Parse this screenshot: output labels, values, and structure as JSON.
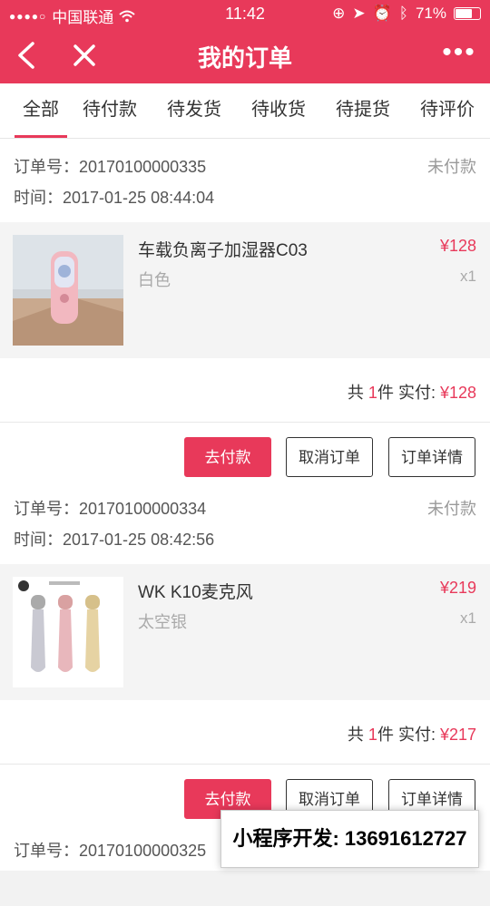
{
  "status_bar": {
    "carrier": "中国联通",
    "time": "11:42",
    "battery": "71%"
  },
  "navbar": {
    "title": "我的订单"
  },
  "tabs": [
    {
      "label": "全部"
    },
    {
      "label": "待付款"
    },
    {
      "label": "待发货"
    },
    {
      "label": "待收货"
    },
    {
      "label": "待提货"
    },
    {
      "label": "待评价"
    }
  ],
  "orders": [
    {
      "order_no": "订单号：20170100000335",
      "time": "时间：2017-01-25 08:44:04",
      "status": "未付款",
      "item": {
        "name": "车载负离子加湿器C03",
        "spec": "白色",
        "price": "¥128",
        "qty": "x1"
      },
      "summary": {
        "prefix": "共 ",
        "count": "1",
        "mid": "件  实付: ",
        "total": "¥128"
      },
      "buttons": {
        "pay": "去付款",
        "cancel": "取消订单",
        "detail": "订单详情"
      }
    },
    {
      "order_no": "订单号：20170100000334",
      "time": "时间：2017-01-25 08:42:56",
      "status": "未付款",
      "item": {
        "name": "WK K10麦克风",
        "spec": "太空银",
        "price": "¥219",
        "qty": "x1"
      },
      "summary": {
        "prefix": "共 ",
        "count": "1",
        "mid": "件  实付: ",
        "total": "¥217"
      },
      "buttons": {
        "pay": "去付款",
        "cancel": "取消订单",
        "detail": "订单详情"
      }
    },
    {
      "order_no": "订单号：20170100000325"
    }
  ],
  "watermark": "小程序开发:  13691612727"
}
